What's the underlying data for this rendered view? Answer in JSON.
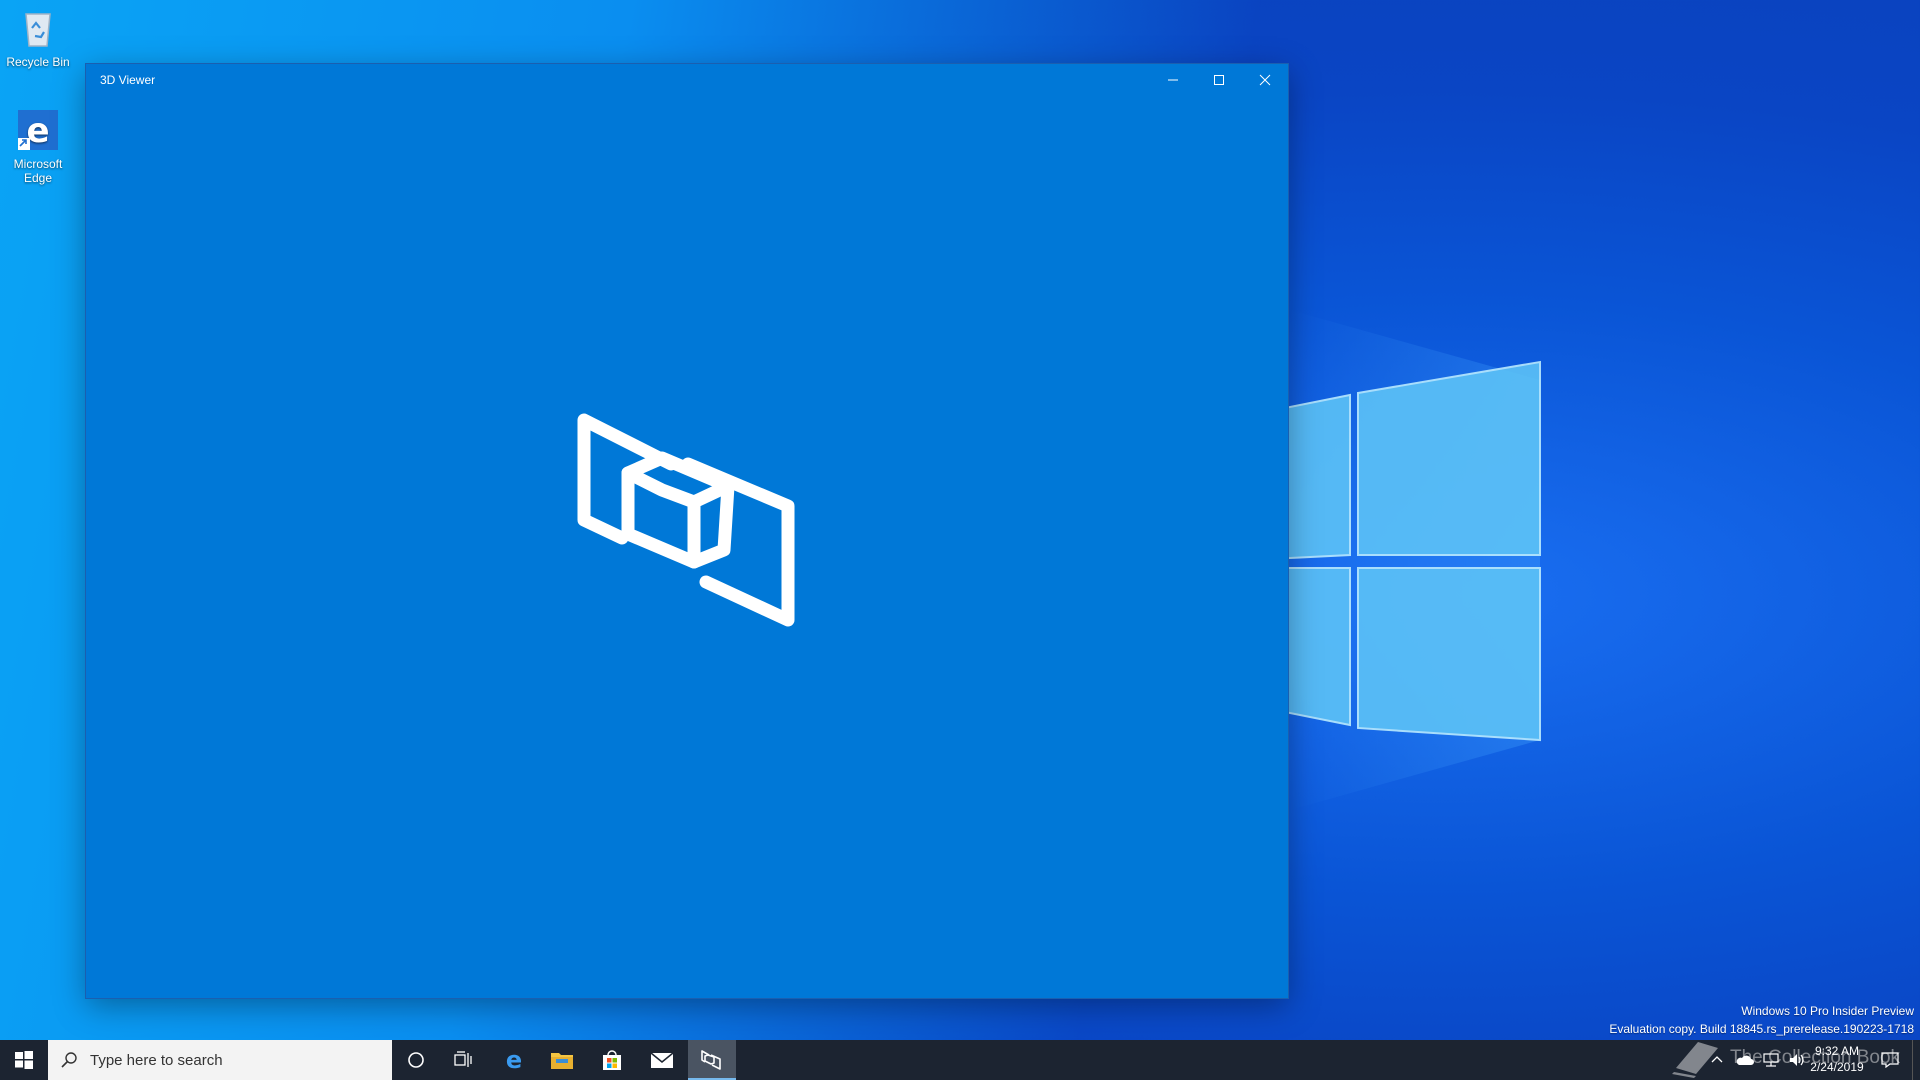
{
  "desktop": {
    "icons": [
      {
        "label": "Recycle Bin"
      },
      {
        "label": "Microsoft Edge"
      }
    ]
  },
  "window": {
    "title": "3D Viewer",
    "background": "#0078d7",
    "controls": [
      "minimize-icon",
      "maximize-icon",
      "close-icon"
    ]
  },
  "taskbar": {
    "search_placeholder": "Type here to search",
    "pinned": [
      "cortana-icon",
      "task-view-icon",
      "edge-icon",
      "file-explorer-icon",
      "store-icon",
      "mail-icon",
      "3d-viewer-app"
    ],
    "clock": {
      "time": "9:32 AM",
      "date": "2/24/2019"
    }
  },
  "watermark": {
    "line1": "Windows 10 Pro Insider Preview",
    "line2": "Evaluation copy. Build 18845.rs_prerelease.190223-1718"
  },
  "overlay": {
    "text": "The Collection Book"
  },
  "colors": {
    "accent": "#0078d7",
    "taskbar": "#1c2431",
    "desktop": "#0a55d6"
  }
}
